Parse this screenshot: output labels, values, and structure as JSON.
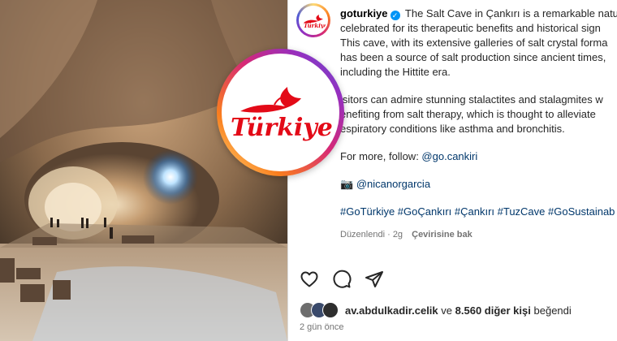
{
  "post": {
    "username": "goturkiye",
    "verified_mark": "✓",
    "caption": {
      "line1": "The Salt Cave in Çankırı is a remarkable natu",
      "line2": "celebrated for its therapeutic benefits and historical sign",
      "line3": "This cave, with its extensive galleries of salt crystal forma",
      "line4": "has been a source of salt production since ancient times,",
      "line5": "including the Hittite era.",
      "p2_line1": "isitors can admire stunning stalactites and stalagmites w",
      "p2_line2": "enefiting from salt therapy, which is thought to alleviate",
      "p2_line3": "espiratory conditions like asthma and bronchitis.",
      "follow_prefix": "For more, follow: ",
      "follow_handle": "@go.cankiri",
      "camera_emoji": "📷",
      "photo_credit": "@nicanorgarcia",
      "hashtags": "#GoTürkiye #GoÇankırı #Çankırı #TuzCave #GoSustainab"
    },
    "meta": {
      "edited": "Düzenlendi · 2g",
      "see_translation": "Çevirisine bak"
    },
    "likes": {
      "first_user": "av.abdulkadir.celik",
      "connector": "ve",
      "others": "8.560 diğer kişi",
      "suffix": "beğendi"
    },
    "time_ago": "2 gün önce"
  },
  "logo": {
    "text": "Türkiye",
    "brand_color": "#e30a17"
  },
  "icons": [
    "like-heart-icon",
    "comment-icon",
    "share-icon",
    "verified-badge-icon"
  ],
  "colors": {
    "link": "#00376b",
    "verified": "#0095f6",
    "muted": "#737373"
  }
}
